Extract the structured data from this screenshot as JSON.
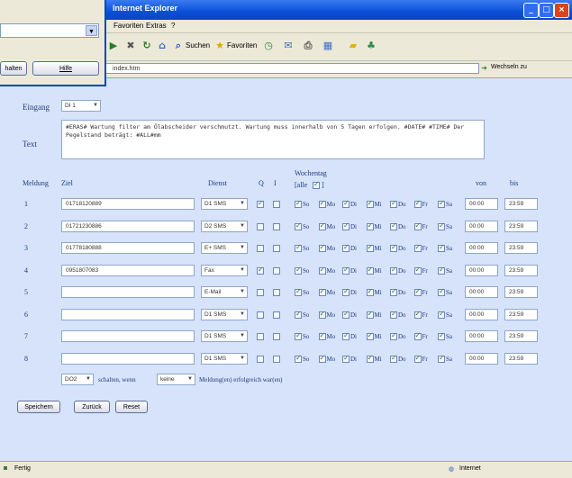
{
  "window": {
    "title": "Internet Explorer"
  },
  "menu": {
    "items": [
      "Favoriten",
      "Extras",
      "?"
    ]
  },
  "toolbar": {
    "search_label": "Suchen",
    "favorites_label": "Favoriten"
  },
  "address": {
    "url": "index.htm",
    "go_label": "Wechseln zu"
  },
  "dialog": {
    "btn_left": "halten",
    "btn_help": "Hilfe"
  },
  "form": {
    "eingang_label": "Eingang",
    "eingang_value": "DI 1",
    "text_label": "Text",
    "text_value": "#ERAS# Wartung filter am Ölabscheider verschmutzt. Wartung muss innerhalb von 5 Tagen erfolgen. #DATE# #TIME# Der Pegelstand beträgt: #ALL#mm",
    "headers": {
      "meldung": "Meldung",
      "ziel": "Ziel",
      "dienst": "Dienst",
      "q": "Q",
      "i": "I",
      "wochentag": "Wochentag",
      "alle": "[alle",
      "alle_end": "]",
      "von": "von",
      "bis": "bis"
    },
    "days": [
      "So",
      "Mo",
      "Di",
      "Mi",
      "Do",
      "Fr",
      "Sa"
    ],
    "rows": [
      {
        "num": "1",
        "ziel": "01718120889",
        "dienst": "D1 SMS",
        "q": true,
        "i": false,
        "von": "00:00",
        "bis": "23:59"
      },
      {
        "num": "2",
        "ziel": "01721230886",
        "dienst": "D2 SMS",
        "q": false,
        "i": false,
        "von": "00:00",
        "bis": "23:59"
      },
      {
        "num": "3",
        "ziel": "01778180888",
        "dienst": "E+ SMS",
        "q": false,
        "i": false,
        "von": "00:00",
        "bis": "23:59"
      },
      {
        "num": "4",
        "ziel": "0951807083",
        "dienst": "Fax",
        "q": true,
        "i": false,
        "von": "00:00",
        "bis": "23:59"
      },
      {
        "num": "5",
        "ziel": "",
        "dienst": "E-Mail",
        "q": false,
        "i": false,
        "von": "00:00",
        "bis": "23:59"
      },
      {
        "num": "6",
        "ziel": "",
        "dienst": "D1 SMS",
        "q": false,
        "i": false,
        "von": "00:00",
        "bis": "23:59"
      },
      {
        "num": "7",
        "ziel": "",
        "dienst": "D1 SMS",
        "q": false,
        "i": false,
        "von": "00:00",
        "bis": "23:59"
      },
      {
        "num": "8",
        "ziel": "",
        "dienst": "D1 SMS",
        "q": false,
        "i": false,
        "von": "00:00",
        "bis": "23:59"
      }
    ],
    "bottom": {
      "select1": "DO2",
      "text1": "schalten, wenn",
      "select2": "keine",
      "text2": "Meldung(en) erfolgreich war(en)"
    },
    "buttons": {
      "save": "Speichern",
      "back": "Zurück",
      "reset": "Reset"
    }
  },
  "status": {
    "left": "Fertig",
    "right": "Internet"
  }
}
